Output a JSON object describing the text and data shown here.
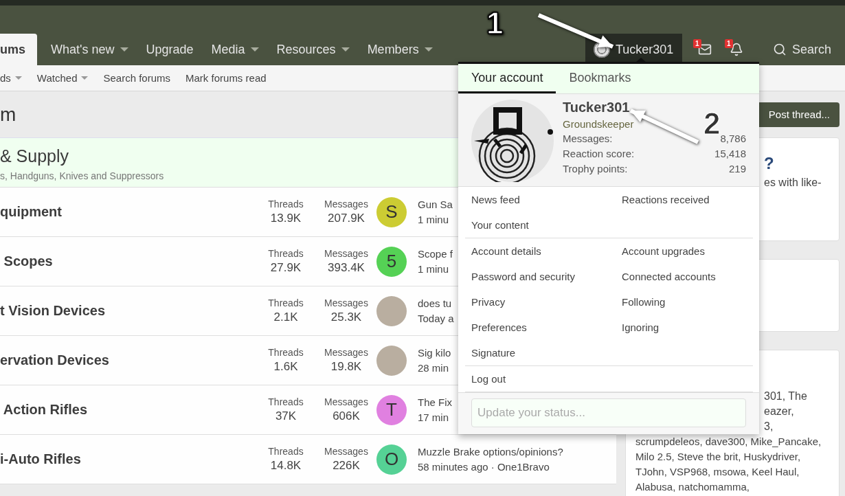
{
  "top_nav": {
    "tabs": [
      {
        "label": "ums",
        "selected": true,
        "dropdown": false
      },
      {
        "label": "What's new",
        "selected": false,
        "dropdown": true
      },
      {
        "label": "Upgrade",
        "selected": false,
        "dropdown": false
      },
      {
        "label": "Media",
        "selected": false,
        "dropdown": true
      },
      {
        "label": "Resources",
        "selected": false,
        "dropdown": true
      },
      {
        "label": "Members",
        "selected": false,
        "dropdown": true
      }
    ],
    "user": {
      "name": "Tucker301",
      "open": true
    },
    "alerts": [
      {
        "kind": "mail",
        "badge": "1"
      },
      {
        "kind": "bell",
        "badge": "1"
      }
    ],
    "search": "Search"
  },
  "sub_nav": [
    {
      "label": "ds",
      "dropdown": true
    },
    {
      "label": "Watched",
      "dropdown": true
    },
    {
      "label": "Search forums",
      "dropdown": false
    },
    {
      "label": "Mark forums read",
      "dropdown": false
    }
  ],
  "page_title": "m",
  "post_button": "Post thread...",
  "category": {
    "title": "& Supply",
    "description": "s, Handguns, Knives and Suppressors"
  },
  "forums": [
    {
      "title": "quipment",
      "threads_label": "Threads",
      "threads": "13.9K",
      "messages_label": "Messages",
      "messages": "207.9K",
      "avatar": {
        "kind": "letter",
        "letter": "S",
        "color": "#cccc33"
      },
      "last_post_title": "Gun Sa",
      "last_post_meta": "1 minu"
    },
    {
      "title": " Scopes",
      "threads_label": "Threads",
      "threads": "27.9K",
      "messages_label": "Messages",
      "messages": "393.4K",
      "avatar": {
        "kind": "letter",
        "letter": "5",
        "color": "#55d155"
      },
      "last_post_title": "Scope f",
      "last_post_meta": "1 minu"
    },
    {
      "title": "t Vision Devices",
      "threads_label": "Threads",
      "threads": "2.1K",
      "messages_label": "Messages",
      "messages": "25.3K",
      "avatar": {
        "kind": "photo"
      },
      "last_post_title": "does tu",
      "last_post_meta": "Today a"
    },
    {
      "title": "ervation Devices",
      "threads_label": "Threads",
      "threads": "1.6K",
      "messages_label": "Messages",
      "messages": "19.8K",
      "avatar": {
        "kind": "photo"
      },
      "last_post_title": "Sig kilo",
      "last_post_meta": "28 min"
    },
    {
      "title": " Action Rifles",
      "threads_label": "Threads",
      "threads": "37K",
      "messages_label": "Messages",
      "messages": "606K",
      "avatar": {
        "kind": "letter",
        "letter": "T",
        "color": "#e080e0"
      },
      "last_post_title": "The Fix",
      "last_post_meta": "17 min"
    },
    {
      "title": "i-Auto Rifles",
      "threads_label": "Threads",
      "threads": "14.8K",
      "messages_label": "Messages",
      "messages": "226K",
      "avatar": {
        "kind": "letter",
        "letter": "O",
        "color": "#55d195"
      },
      "last_post_title": "Muzzle Brake options/opinions?",
      "last_post_meta": "58 minutes ago · One1Bravo"
    }
  ],
  "sidebar": [
    {
      "partly_covered_lines": [
        "?",
        "es with like-"
      ]
    },
    {
      "partly_covered_lines": [
        "301, The",
        "eazer,",
        "3,"
      ],
      "lines": [
        "scrumpdeleos, dave300, Mike_Pancake,",
        "Milo 2.5, Steve the brit, Huskydriver,",
        "TJohn, VSP968, msowa, Keel Haul,",
        "Alabusa, natchomamma,"
      ]
    }
  ],
  "account_menu": {
    "tabs": [
      {
        "label": "Your account",
        "selected": true
      },
      {
        "label": "Bookmarks",
        "selected": false
      }
    ],
    "name": "Tucker301",
    "role": "Groundskeeper",
    "stats": [
      {
        "label": "Messages:",
        "value": "8,786"
      },
      {
        "label": "Reaction score:",
        "value": "15,418"
      },
      {
        "label": "Trophy points:",
        "value": "219"
      }
    ],
    "sections": [
      {
        "left": [
          "News feed",
          "Your content"
        ],
        "right": [
          "Reactions received"
        ]
      },
      {
        "left": [
          "Account details",
          "Password and security",
          "Privacy",
          "Preferences",
          "Signature"
        ],
        "right": [
          "Account upgrades",
          "Connected accounts",
          "Following",
          "Ignoring"
        ]
      },
      {
        "left": [
          "Log out"
        ]
      }
    ],
    "status_placeholder": "Update your status..."
  },
  "annotations": [
    {
      "label": "1"
    },
    {
      "label": "2"
    }
  ]
}
